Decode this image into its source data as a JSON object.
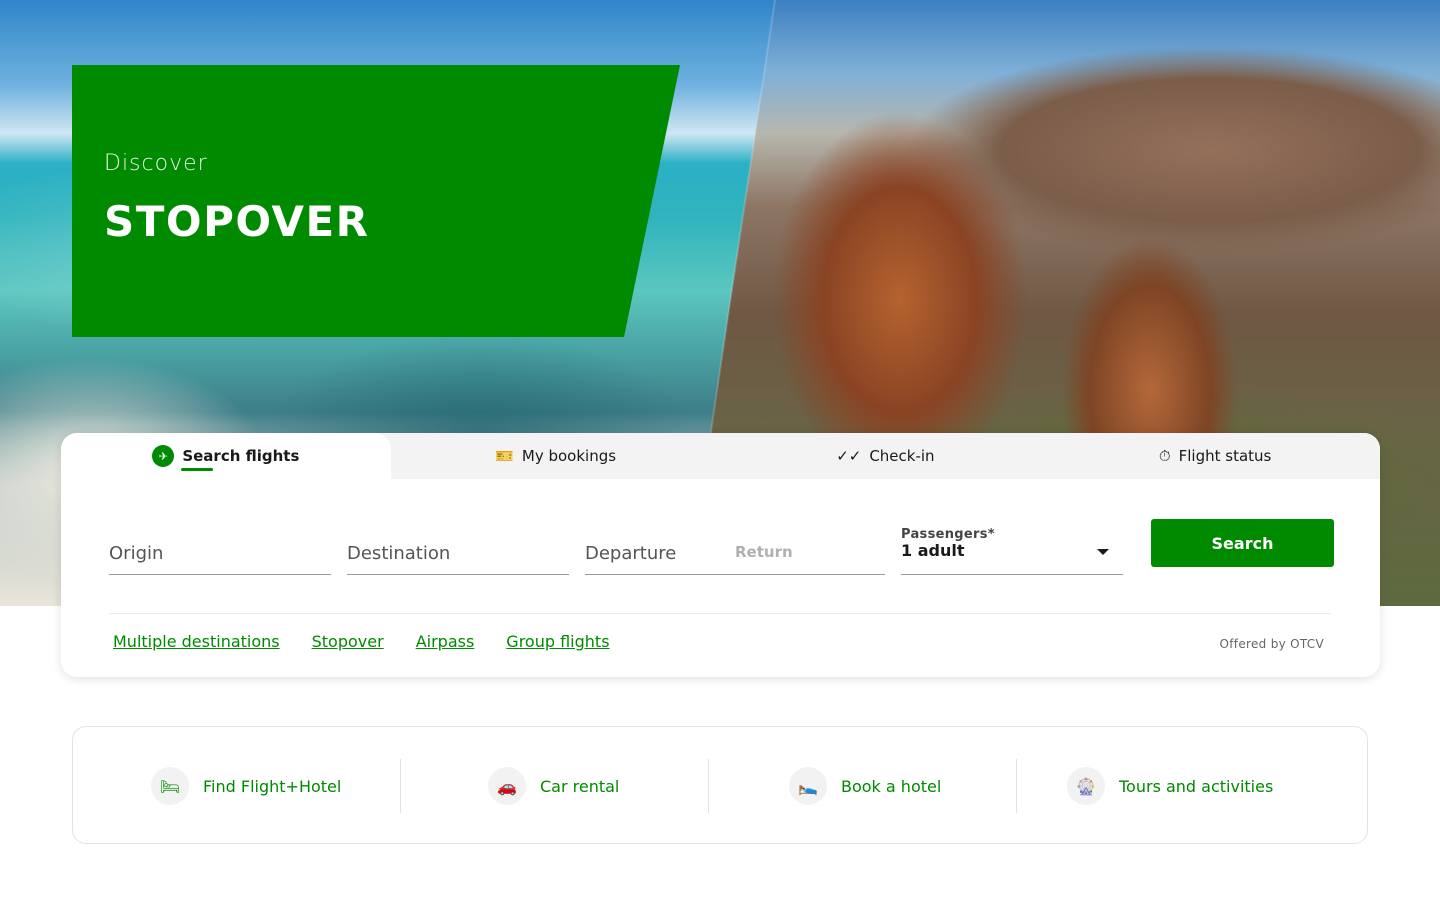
{
  "promo": {
    "kicker": "Discover",
    "title": "STOPOVER"
  },
  "tabs": [
    {
      "label": "Search flights",
      "icon": "flight-icon"
    },
    {
      "label": "My bookings",
      "icon": "airplane-ticket-icon"
    },
    {
      "label": "Check-in",
      "icon": "done-all-icon"
    },
    {
      "label": "Flight status",
      "icon": "av-timer-icon"
    }
  ],
  "form": {
    "origin": "Origin",
    "destination": "Destination",
    "departure": "Departure",
    "return": "Return",
    "passengers_label": "Passengers*",
    "passengers_value": "1 adult",
    "search_label": "Search"
  },
  "links": [
    "Multiple destinations",
    "Stopover",
    "Airpass",
    "Group flights"
  ],
  "offered_by": "Offered by OTCV",
  "quick_links": [
    {
      "label": "Find Flight+Hotel",
      "icon": "hotel-icon"
    },
    {
      "label": "Car rental",
      "icon": "directions-car-icon"
    },
    {
      "label": "Book a hotel",
      "icon": "king-bed-icon"
    },
    {
      "label": "Tours and activities",
      "icon": "attractions-icon"
    }
  ],
  "colors": {
    "brand": "#008a00"
  }
}
